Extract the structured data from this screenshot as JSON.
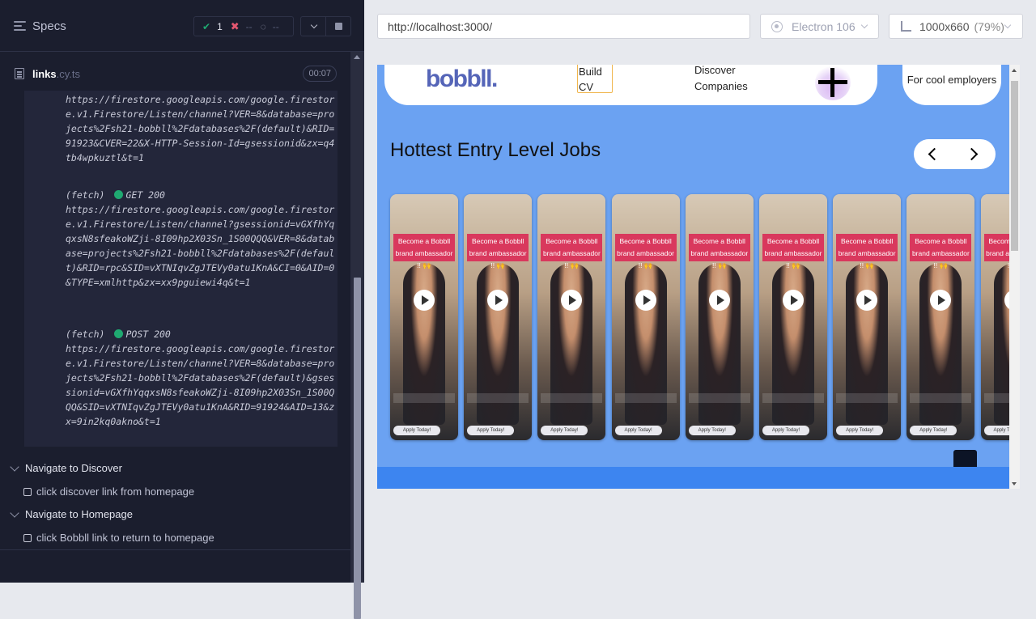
{
  "reporter": {
    "specs_label": "Specs",
    "stats": {
      "passed": "1",
      "failed": "--",
      "pending": "--"
    },
    "spec_file": {
      "name": "links",
      "ext": ".cy.ts",
      "duration": "00:07"
    },
    "log": [
      {
        "text": "https://firestore.googleapis.com/google.firestore.v1.Firestore/Listen/channel?VER=8&database=projects%2Fsh21-bobbll%2Fdatabases%2F(default)&RID=91923&CVER=22&X-HTTP-Session-Id=gsessionid&zx=q4tb4wpkuztl&t=1"
      },
      {
        "type": "(fetch)",
        "method": "GET 200",
        "text": "https://firestore.googleapis.com/google.firestore.v1.Firestore/Listen/channel?gsessionid=vGXfhYqqxsN8sfeakoWZji-8I09hp2X03Sn_1S00QQQ&VER=8&database=projects%2Fsh21-bobbll%2Fdatabases%2F(default)&RID=rpc&SID=vXTNIqvZgJTEVy0atu1KnA&CI=0&AID=0&TYPE=xmlhttp&zx=xx9pguiewi4q&t=1"
      },
      {
        "type": "(fetch)",
        "method": "POST 200",
        "text": "https://firestore.googleapis.com/google.firestore.v1.Firestore/Listen/channel?VER=8&database=projects%2Fsh21-bobbll%2Fdatabases%2F(default)&gsessionid=vGXfhYqqxsN8sfeakoWZji-8I09hp2X03Sn_1S00QQQ&SID=vXTNIqvZgJTEVy0atu1KnA&RID=91924&AID=13&zx=9in2kq0akno&t=1"
      }
    ],
    "suites": [
      {
        "title": "Navigate to Discover",
        "test": "click discover link from homepage"
      },
      {
        "title": "Navigate to Homepage",
        "test": "click Bobbll link to return to homepage"
      }
    ]
  },
  "toolbar": {
    "url": "http://localhost:3000/",
    "browser": "Electron 106",
    "viewport": "1000x660",
    "scale": "(79%)"
  },
  "app": {
    "logo": "bobbll.",
    "nav": {
      "build_cv": "Build CV",
      "discover": "Discover Companies",
      "employers": "For cool employers"
    },
    "section_title": "Hottest Entry Level Jobs",
    "card": {
      "banner": "Become a Bobbll brand ambassador !! 🙌",
      "apply": "Apply Today!"
    },
    "card_count": 9
  },
  "colors": {
    "reporter_bg": "#1b1e2e",
    "pass_green": "#1fa971",
    "app_bg": "#6ba2f2",
    "footer_blue": "#3d85f0",
    "banner_pink": "#d9385d"
  },
  "icons": [
    "specs-list-icon",
    "check-icon",
    "x-icon",
    "spinner-icon",
    "chevron-down-icon",
    "stop-icon",
    "file-icon",
    "electron-icon",
    "ruler-icon",
    "plus-icon",
    "play-icon",
    "arrow-left-icon",
    "arrow-right-icon"
  ]
}
